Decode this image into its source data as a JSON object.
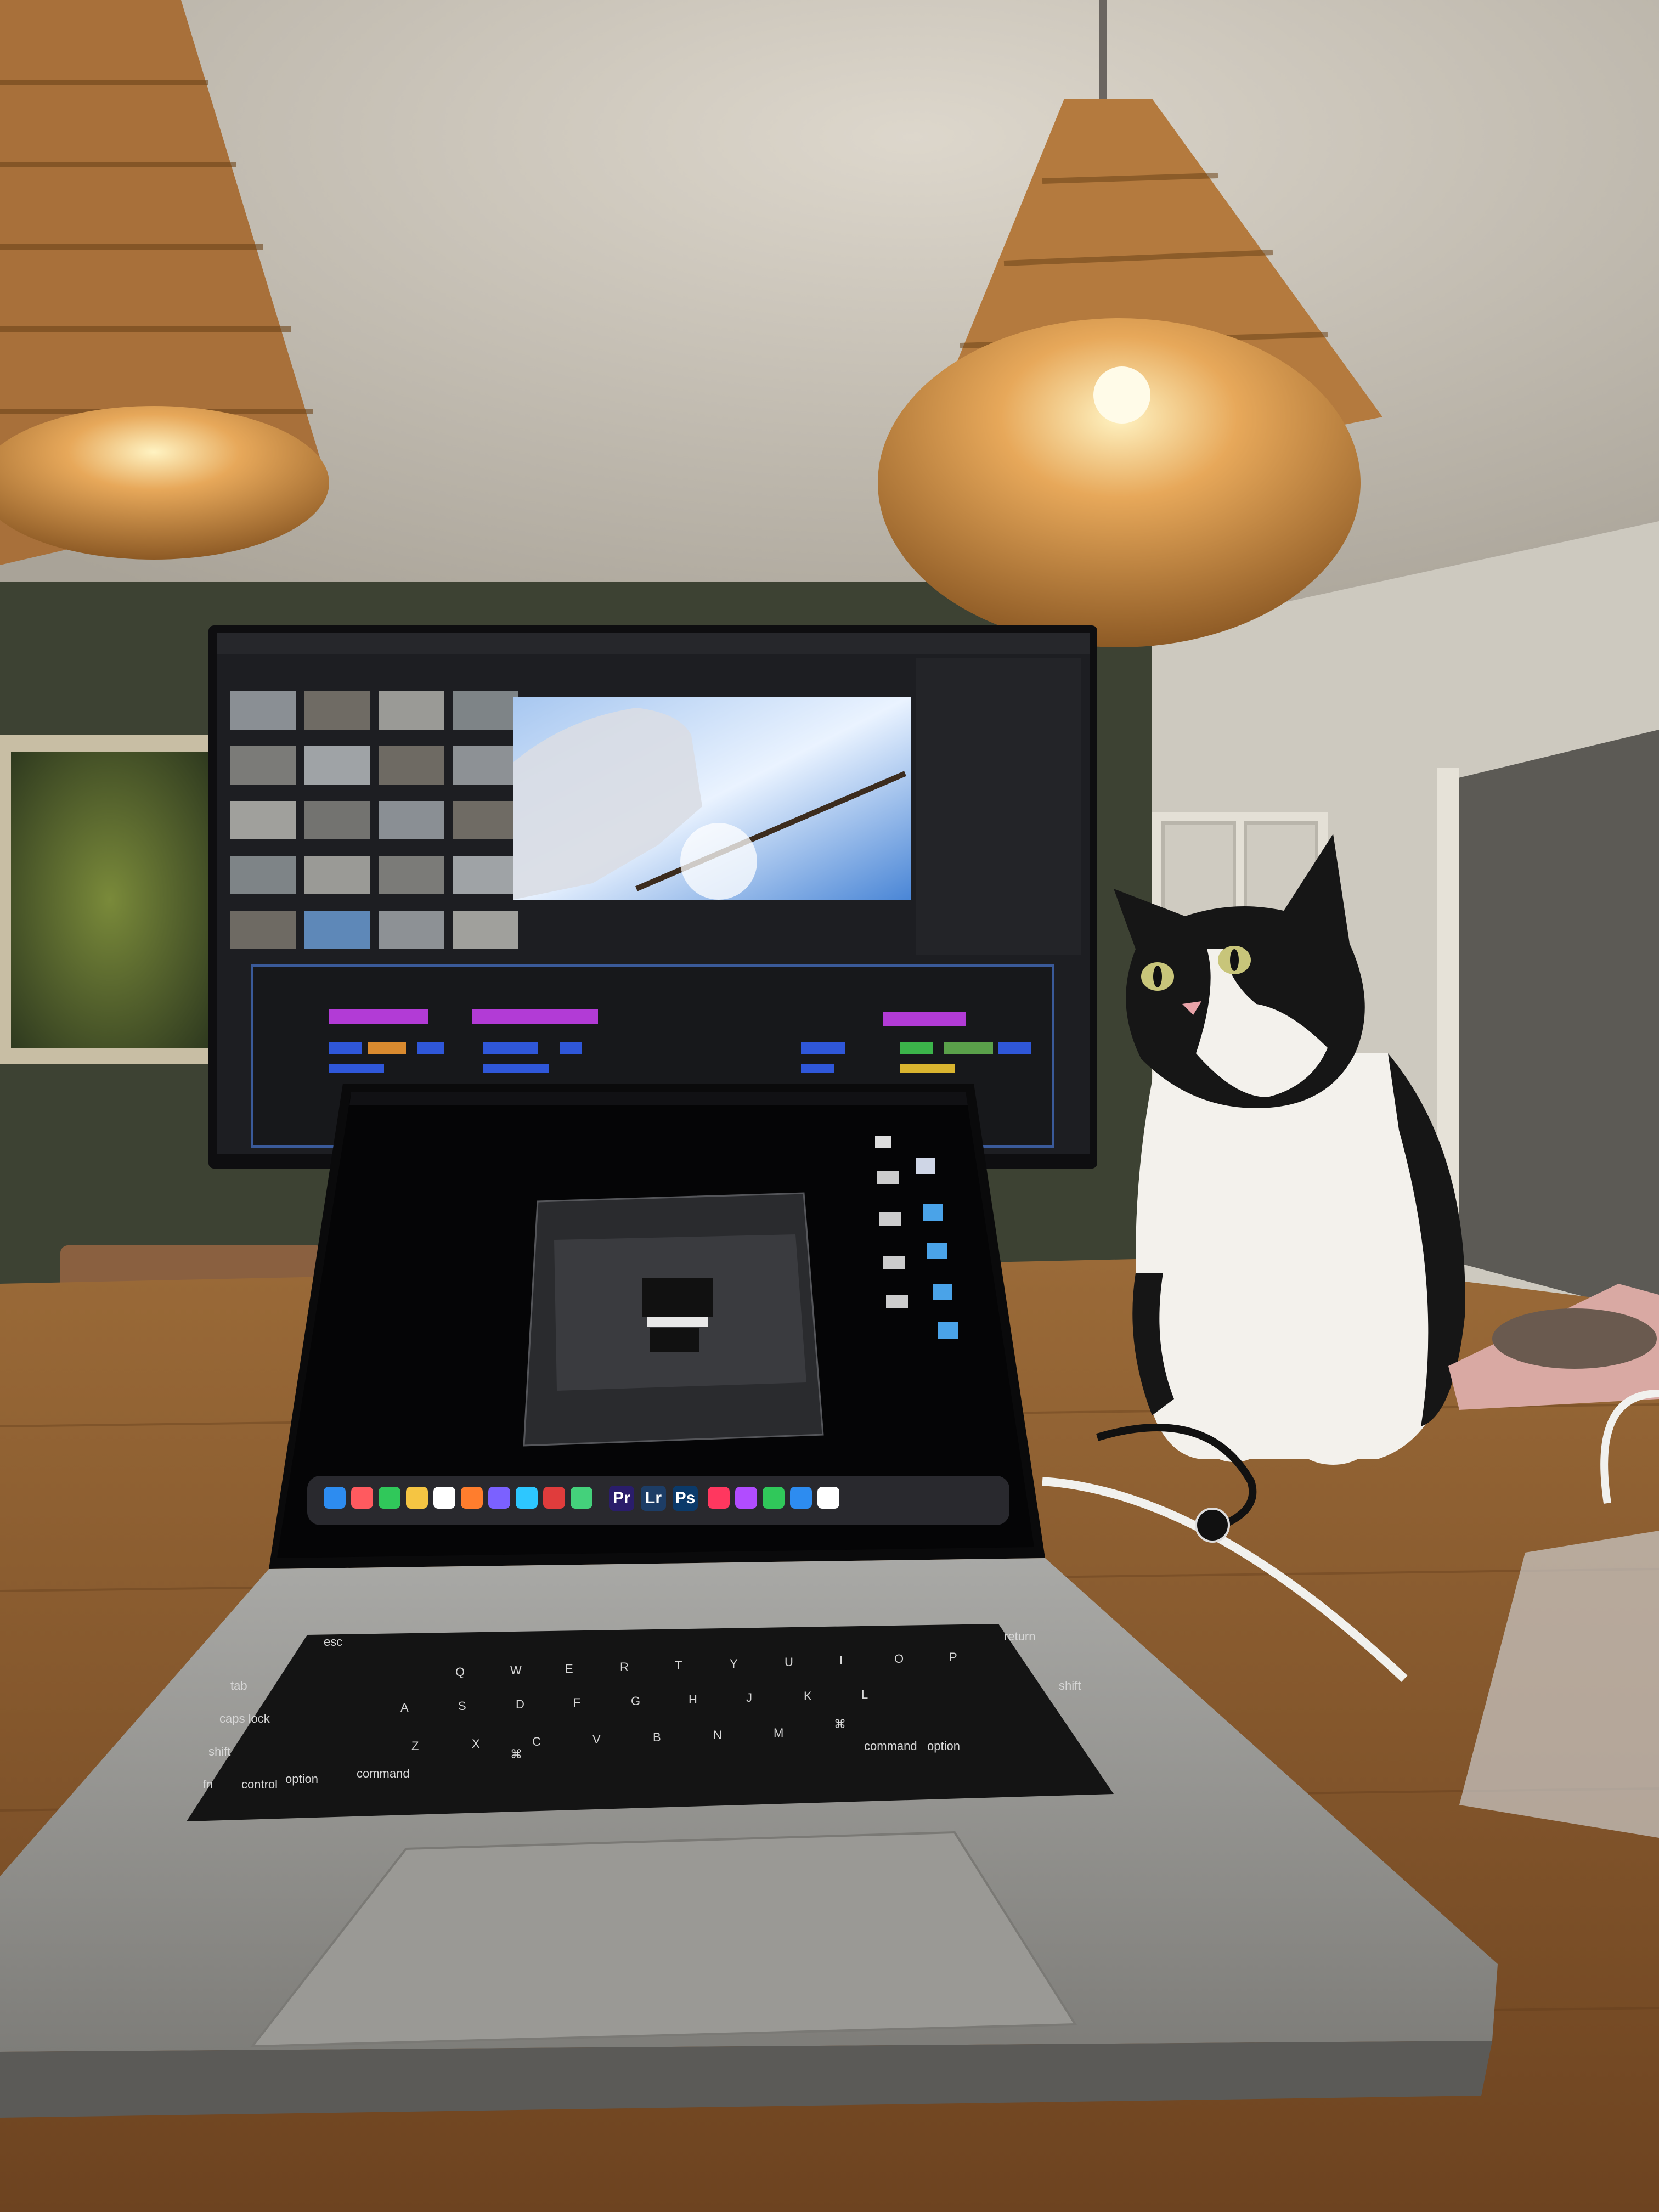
{
  "keyboard": {
    "keys": [
      "esc",
      "tab",
      "caps lock",
      "shift",
      "fn",
      "control",
      "option",
      "command",
      "return",
      "shift",
      "command",
      "option",
      "⌘",
      "⌘"
    ],
    "letters": [
      "Q",
      "W",
      "E",
      "R",
      "T",
      "Y",
      "U",
      "I",
      "O",
      "P",
      "A",
      "S",
      "D",
      "F",
      "G",
      "H",
      "J",
      "K",
      "L",
      "Z",
      "X",
      "C",
      "V",
      "B",
      "N",
      "M"
    ]
  },
  "dock_apps": [
    {
      "name": "Pr",
      "color": "#2a1d6b"
    },
    {
      "name": "Lr",
      "color": "#1d3d66"
    },
    {
      "name": "Ps",
      "color": "#0b3a6a"
    }
  ],
  "colors": {
    "wall": "#c9c3b6",
    "table": "#8a5a2c",
    "lamp": "#c98f4a",
    "premiere_bg": "#1d1e22",
    "clip_purple": "#b23bd6",
    "clip_blue": "#2f57d9",
    "sky": "#6f9fe0"
  }
}
